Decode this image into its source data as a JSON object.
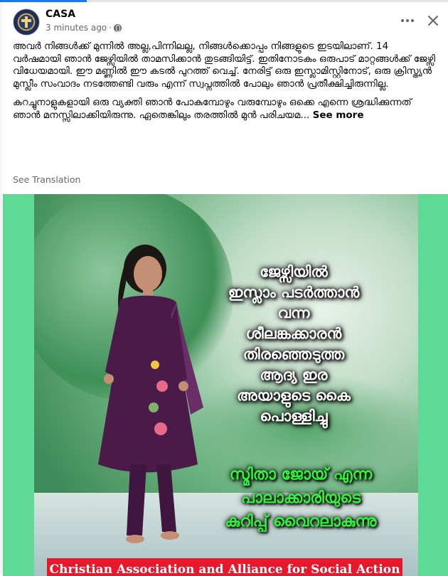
{
  "post": {
    "author": "CASA",
    "timestamp": "3 minutes ago",
    "separator": "·",
    "privacy_icon": "globe-icon",
    "paragraph1": "അവർ നിങ്ങൾക്ക് മുന്നിൽ അല്ല,പിന്നിലല്ല, നിങ്ങൾക്കൊപ്പം നിങ്ങളുടെ ഇടയിലാണ്. 14 വർഷമായി ഞാൻ ജേഴ്സിയിൽ താമസിക്കാൻ തുടങ്ങിയിട്ട്. ഇതിനോടകം ഒരുപാട് മാറ്റങ്ങൾക്ക് ജേഴ്സി വിധേയമായി. ഈ മണ്ണിൽ ഈ കടൽ പുറത്ത് വെച്ച്. നേരിട്ട് ഒരു ഇസ്ലാമിസ്റ്റിനോട്, ഒരു ക്രിസ്ത്യൻ മുസ്ലീം സംവാദം നടത്തേണ്ടി വരും എന്ന് സ്വപ്നത്തിൽ പോലും ഞാൻ പ്രതീക്ഷിച്ചിരുന്നില്ല.",
    "paragraph2": "കുറച്ചുനാളുകളായി ഒരു വ്യക്തി ഞാൻ പോകുമ്പോഴും വരുമ്പോഴും ഒക്കെ എന്നെ ശ്രദ്ധിക്കുന്നത് ഞാൻ മനസ്സിലാക്കിയിരുന്നു. ഏതെങ്കിലും തരത്തിൽ മുൻ പരിചയമ...",
    "see_more": "See more",
    "see_translation": "See Translation"
  },
  "header": {
    "more_icon": "more-icon",
    "close_icon": "close-icon"
  },
  "image": {
    "headline_lines": [
      "ജേഴ്സിയിൽ",
      "ഇസ്ലാം പടർത്താൻ",
      "വന്ന",
      "ശീലങ്കക്കാരൻ",
      "തിരഞ്ഞെടുത്ത",
      "ആദ്യ ഇര",
      "അയാളുടെ കൈ",
      "പൊള്ളിച്ചു"
    ],
    "sub_lines": [
      "സ്മിതാ ജോയ് എന്ന",
      "പാലാക്കാരിയുടെ",
      "കുറിപ്പ് വൈറലാകുന്നു"
    ],
    "banner": "Christian Association and Alliance for Social Action"
  },
  "colors": {
    "accent": "#1877f2",
    "photo_bg": "#5fd996",
    "banner_bg": "#e8182c",
    "headline_green": "#2ff23a"
  }
}
